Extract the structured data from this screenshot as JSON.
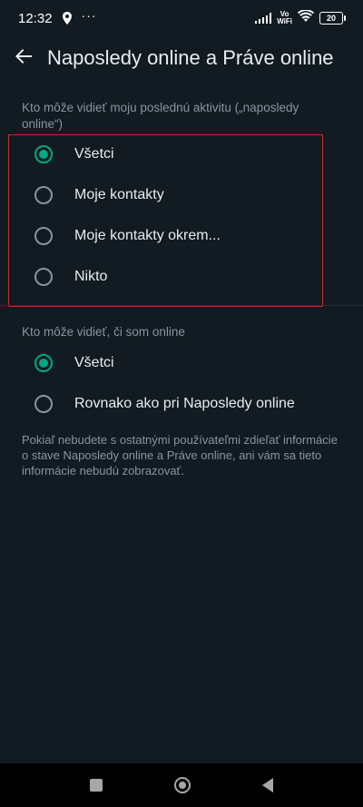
{
  "status_bar": {
    "time": "12:32",
    "battery": "20",
    "vowifi_top": "Vo",
    "vowifi_bottom": "WiFi",
    "dots": "···",
    "icons": [
      "location-icon",
      "signal-icon",
      "wifi-icon",
      "battery-icon"
    ]
  },
  "header": {
    "title": "Naposledy online a Práve online",
    "back_icon": "arrow-left-icon"
  },
  "last_seen": {
    "label": "Kto môže vidieť moju poslednú aktivitu („naposledy online“)",
    "options": [
      {
        "label": "Všetci",
        "selected": true
      },
      {
        "label": "Moje kontakty",
        "selected": false
      },
      {
        "label": "Moje kontakty okrem...",
        "selected": false
      },
      {
        "label": "Nikto",
        "selected": false
      }
    ]
  },
  "online": {
    "label": "Kto môže vidieť, či som online",
    "options": [
      {
        "label": "Všetci",
        "selected": true
      },
      {
        "label": "Rovnako ako pri Naposledy online",
        "selected": false
      }
    ]
  },
  "footer_note": "Pokiaľ nebudete s ostatnými používateľmi zdieľať informácie o stave Naposledy online a Práve online, ani vám sa tieto informácie nebudú zobrazovať.",
  "colors": {
    "background": "#111b21",
    "accent": "#00a884",
    "highlight": "#d2282c"
  }
}
